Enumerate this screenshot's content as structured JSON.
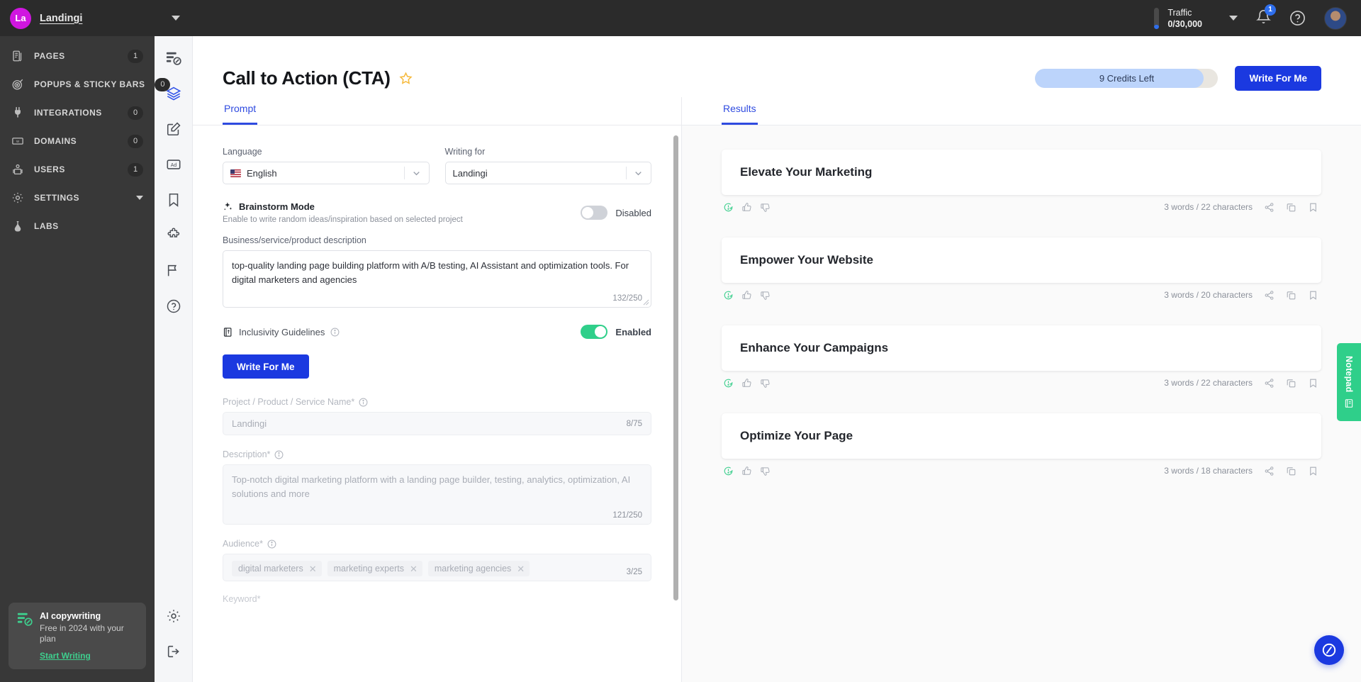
{
  "topbar": {
    "brand_initials": "La",
    "brand_name": "Landingi",
    "traffic_label": "Traffic",
    "traffic_value": "0/30,000",
    "notification_count": "1",
    "icons": {
      "bell": "bell-icon",
      "help": "help-circle-icon",
      "avatar": "user-avatar"
    }
  },
  "sidebar": {
    "items": [
      {
        "label": "PAGES",
        "count": "1",
        "icon": "pages-icon"
      },
      {
        "label": "POPUPS & STICKY BARS",
        "count": "0",
        "icon": "target-icon"
      },
      {
        "label": "INTEGRATIONS",
        "count": "0",
        "icon": "plug-icon"
      },
      {
        "label": "DOMAINS",
        "count": "0",
        "icon": "domain-icon"
      },
      {
        "label": "USERS",
        "count": "1",
        "icon": "users-icon"
      },
      {
        "label": "SETTINGS",
        "count": "",
        "icon": "gear-icon",
        "caret": true
      },
      {
        "label": "LABS",
        "count": "",
        "icon": "flask-icon"
      }
    ],
    "promo": {
      "title": "AI copywriting",
      "subtitle": "Free in 2024 with your plan",
      "link": "Start Writing",
      "icon": "ai-copywriting-icon"
    }
  },
  "rail": {
    "items": [
      {
        "icon": "ai-writer-icon",
        "active": false
      },
      {
        "icon": "layers-icon",
        "active": true
      },
      {
        "icon": "edit-square-icon",
        "active": false
      },
      {
        "icon": "ad-icon",
        "active": false
      },
      {
        "icon": "bookmark-icon",
        "active": false
      },
      {
        "icon": "puzzle-icon",
        "active": false
      },
      {
        "icon": "flag-icon",
        "active": false
      },
      {
        "icon": "help-circle-icon",
        "active": false
      }
    ],
    "bottom": [
      {
        "icon": "gear-icon"
      },
      {
        "icon": "logout-icon"
      }
    ]
  },
  "header": {
    "title": "Call to Action (CTA)",
    "star_icon": "star-icon",
    "credits_text": "9 Credits Left",
    "credits_percent": 92,
    "write_button": "Write For Me"
  },
  "prompt_pane": {
    "tab_label": "Prompt",
    "language": {
      "label": "Language",
      "value": "English",
      "flag": "us-flag-icon"
    },
    "writing_for": {
      "label": "Writing for",
      "value": "Landingi"
    },
    "brainstorm": {
      "title": "Brainstorm Mode",
      "subtitle": "Enable to write random ideas/inspiration based on selected project",
      "state": "Disabled",
      "enabled": false,
      "icon": "sparkle-icon"
    },
    "business_description": {
      "label": "Business/service/product description",
      "value": "top-quality landing page building platform with A/B testing, AI Assistant and optimization tools. For digital marketers and agencies",
      "counter": "132/250"
    },
    "inclusivity": {
      "label": "Inclusivity Guidelines",
      "state": "Enabled",
      "enabled": true,
      "icon": "book-icon"
    },
    "write_button": "Write For Me",
    "project_name": {
      "label": "Project / Product / Service Name*",
      "value": "Landingi",
      "counter": "8/75"
    },
    "description": {
      "label": "Description*",
      "value": "Top-notch digital marketing platform with a landing page builder, testing, analytics, optimization, AI solutions and more",
      "counter": "121/250"
    },
    "audience": {
      "label": "Audience*",
      "chips": [
        "digital marketers",
        "marketing experts",
        "marketing agencies"
      ],
      "counter": "3/25"
    },
    "next_label_partial": "Keyword*"
  },
  "results_pane": {
    "tab_label": "Results",
    "cards": [
      {
        "text": "Elevate Your Marketing",
        "meta": "3 words / 22 characters"
      },
      {
        "text": "Empower Your Website",
        "meta": "3 words / 20 characters"
      },
      {
        "text": "Enhance Your Campaigns",
        "meta": "3 words / 22 characters"
      },
      {
        "text": "Optimize Your Page",
        "meta": "3 words / 18 characters"
      }
    ],
    "card_icons": {
      "check": "plagiarism-check-icon",
      "like": "thumbs-up-icon",
      "dislike": "thumbs-down-icon",
      "share": "share-icon",
      "copy": "copy-icon",
      "save": "bookmark-icon"
    }
  },
  "notepad": {
    "label": "Notepad",
    "icon": "notepad-icon"
  },
  "fab": {
    "icon": "landingi-logo-icon"
  },
  "colors": {
    "accent_blue": "#1b39e0",
    "tab_blue": "#2f4be0",
    "brand_magenta": "#d016e0",
    "green": "#2fcf8a",
    "sidebar_bg": "#383838",
    "topbar_bg": "#2b2b2b",
    "star_gold": "#f6b93b"
  }
}
